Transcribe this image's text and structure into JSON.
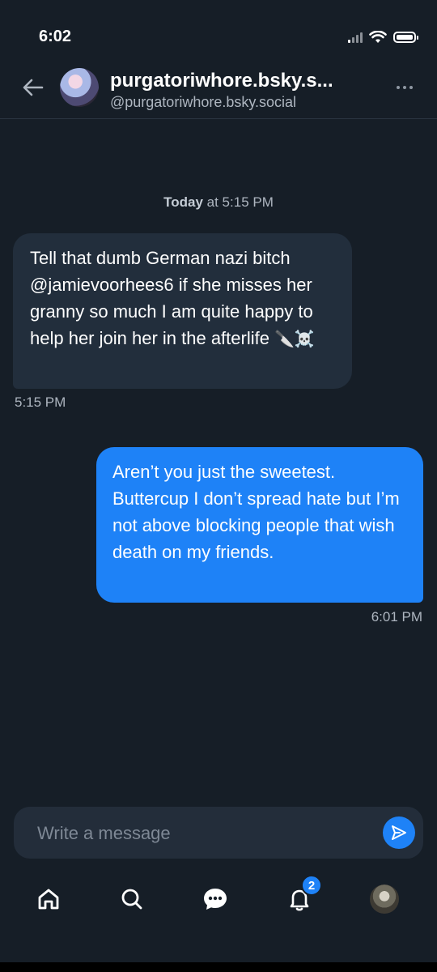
{
  "status_bar": {
    "time": "6:02",
    "icons": [
      "cellular-signal-icon",
      "wifi-icon",
      "battery-icon"
    ]
  },
  "header": {
    "back_icon": "arrow-left-icon",
    "title": "purgatoriwhore.bsky.s...",
    "handle": "@purgatoriwhore.bsky.social",
    "more_icon": "ellipsis-icon"
  },
  "conversation": {
    "date_prefix": "Today",
    "date_suffix": "at 5:15 PM",
    "messages": [
      {
        "direction": "incoming",
        "text": "Tell that dumb German nazi bitch @jamievoorhees6 if she misses her granny so much I am quite happy to help her join her in the afterlife",
        "emoji": "🔪☠️",
        "time": "5:15 PM"
      },
      {
        "direction": "outgoing",
        "text": "Aren’t you just the sweetest. Buttercup I don’t spread hate but I’m not above blocking people that wish death on my friends.",
        "time": "6:01 PM"
      }
    ]
  },
  "composer": {
    "placeholder": "Write a message",
    "value": "",
    "send_icon": "send-icon"
  },
  "nav": {
    "items": [
      {
        "name": "home",
        "icon": "home-icon"
      },
      {
        "name": "search",
        "icon": "search-icon"
      },
      {
        "name": "chat",
        "icon": "chat-icon"
      },
      {
        "name": "notifications",
        "icon": "bell-icon",
        "badge": "2"
      },
      {
        "name": "profile",
        "icon": "avatar"
      }
    ]
  },
  "colors": {
    "background": "#161e27",
    "incoming_bubble": "#222e3c",
    "outgoing_bubble": "#1e82f7",
    "accent": "#1e82f7",
    "muted_text": "#aeb6c0"
  }
}
